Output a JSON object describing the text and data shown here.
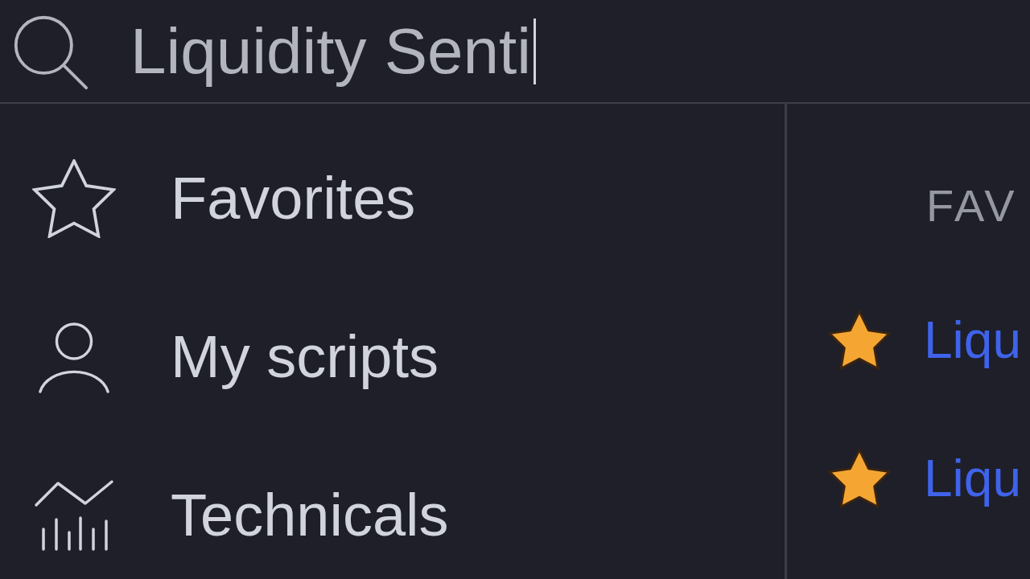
{
  "search": {
    "value": "Liquidity Senti",
    "focused": true
  },
  "sidebar": {
    "items": [
      {
        "label": "Favorites",
        "selected": false
      },
      {
        "label": "My scripts",
        "selected": false
      },
      {
        "label": "Technicals",
        "selected": false
      }
    ]
  },
  "favorites_panel": {
    "heading": "FAV",
    "items": [
      {
        "label": "Liqu",
        "favorite": true
      },
      {
        "label": "Liqu",
        "favorite": true
      }
    ]
  }
}
